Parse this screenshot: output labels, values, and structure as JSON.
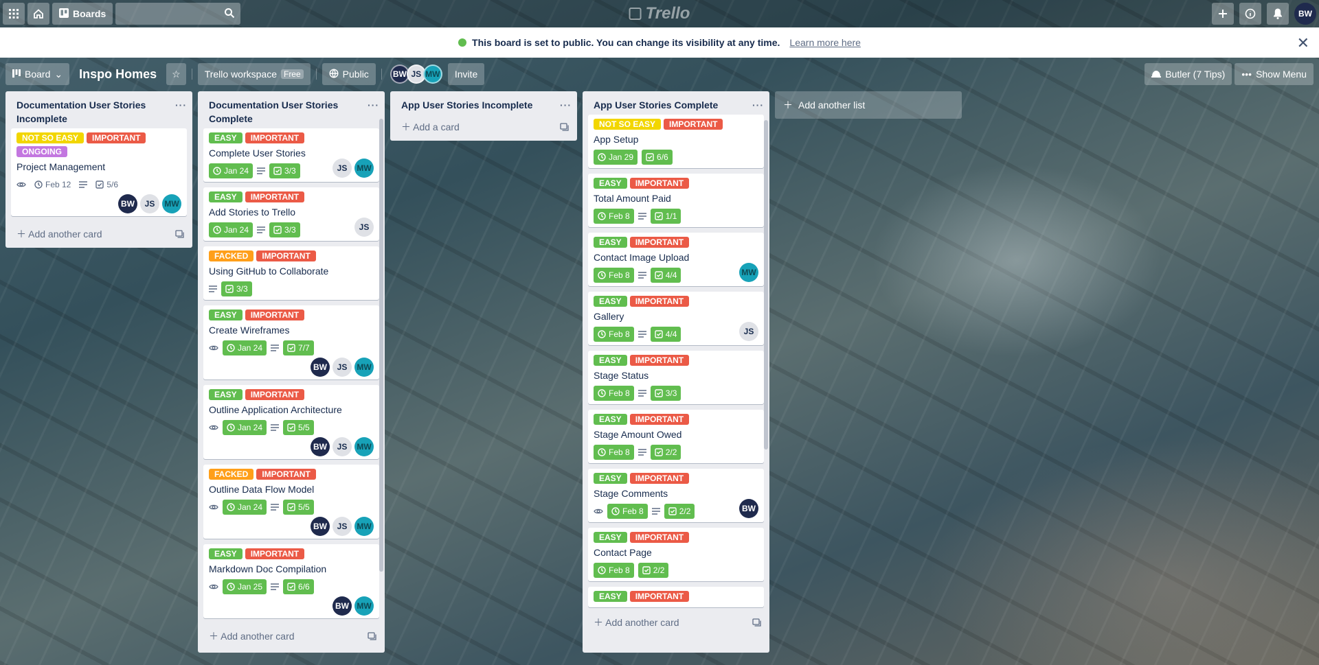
{
  "nav": {
    "boards_label": "Boards",
    "logo_text": "Trello",
    "user_initials": "BW"
  },
  "banner": {
    "message": "This board is set to public. You can change its visibility at any time.",
    "link": "Learn more here"
  },
  "header": {
    "view_label": "Board",
    "title": "Inspo Homes",
    "workspace": "Trello workspace",
    "workspace_plan": "Free",
    "visibility": "Public",
    "invite": "Invite",
    "butler": "Butler (7 Tips)",
    "show_menu": "Show Menu",
    "members": [
      "BW",
      "JS",
      "MW"
    ]
  },
  "add_list": "Add another list",
  "lists": [
    {
      "title": "Documentation User Stories Incomplete",
      "add": "Add another card",
      "cards": [
        {
          "labels": [
            {
              "text": "NOT SO EASY",
              "color": "yellow"
            },
            {
              "text": "IMPORTANT",
              "color": "red"
            },
            {
              "text": "ONGOING",
              "color": "purple"
            }
          ],
          "title": "Project Management",
          "watch": true,
          "date": "Feb 12",
          "date_done": false,
          "desc": true,
          "checklist": "5/6",
          "check_done": false,
          "members": [
            "BW",
            "JS",
            "MW"
          ]
        }
      ]
    },
    {
      "title": "Documentation User Stories Complete",
      "add": "Add another card",
      "cards": [
        {
          "labels": [
            {
              "text": "EASY",
              "color": "green"
            },
            {
              "text": "IMPORTANT",
              "color": "red"
            }
          ],
          "title": "Complete User Stories",
          "date": "Jan 24",
          "desc": true,
          "checklist": "3/3",
          "members_right": [
            "JS",
            "MW"
          ]
        },
        {
          "labels": [
            {
              "text": "EASY",
              "color": "green"
            },
            {
              "text": "IMPORTANT",
              "color": "red"
            }
          ],
          "title": "Add Stories to Trello",
          "date": "Jan 24",
          "desc": true,
          "checklist": "3/3",
          "members_right": [
            "JS"
          ]
        },
        {
          "labels": [
            {
              "text": "FACKED",
              "color": "orange"
            },
            {
              "text": "IMPORTANT",
              "color": "red"
            }
          ],
          "title": "Using GitHub to Collaborate",
          "desc": true,
          "checklist": "3/3"
        },
        {
          "labels": [
            {
              "text": "EASY",
              "color": "green"
            },
            {
              "text": "IMPORTANT",
              "color": "red"
            }
          ],
          "title": "Create Wireframes",
          "watch": true,
          "date": "Jan 24",
          "desc": true,
          "checklist": "7/7",
          "members": [
            "BW",
            "JS",
            "MW"
          ]
        },
        {
          "labels": [
            {
              "text": "EASY",
              "color": "green"
            },
            {
              "text": "IMPORTANT",
              "color": "red"
            }
          ],
          "title": "Outline Application Architecture",
          "watch": true,
          "date": "Jan 24",
          "desc": true,
          "checklist": "5/5",
          "members": [
            "BW",
            "JS",
            "MW"
          ]
        },
        {
          "labels": [
            {
              "text": "FACKED",
              "color": "orange"
            },
            {
              "text": "IMPORTANT",
              "color": "red"
            }
          ],
          "title": "Outline Data Flow Model",
          "watch": true,
          "date": "Jan 24",
          "desc": true,
          "checklist": "5/5",
          "members": [
            "BW",
            "JS",
            "MW"
          ]
        },
        {
          "labels": [
            {
              "text": "EASY",
              "color": "green"
            },
            {
              "text": "IMPORTANT",
              "color": "red"
            }
          ],
          "title": "Markdown Doc Compilation",
          "watch": true,
          "date": "Jan 25",
          "desc": true,
          "checklist": "6/6",
          "members": [
            "BW",
            "MW"
          ]
        }
      ]
    },
    {
      "title": "App User Stories Incomplete",
      "add": "Add a card",
      "cards": []
    },
    {
      "title": "App User Stories Complete",
      "add": "Add another card",
      "cards": [
        {
          "labels": [
            {
              "text": "NOT SO EASY",
              "color": "yellow"
            },
            {
              "text": "IMPORTANT",
              "color": "red"
            }
          ],
          "title": "App Setup",
          "date": "Jan 29",
          "checklist": "6/6"
        },
        {
          "labels": [
            {
              "text": "EASY",
              "color": "green"
            },
            {
              "text": "IMPORTANT",
              "color": "red"
            }
          ],
          "title": "Total Amount Paid",
          "date": "Feb 8",
          "desc": true,
          "checklist": "1/1"
        },
        {
          "labels": [
            {
              "text": "EASY",
              "color": "green"
            },
            {
              "text": "IMPORTANT",
              "color": "red"
            }
          ],
          "title": "Contact Image Upload",
          "date": "Feb 8",
          "desc": true,
          "checklist": "4/4",
          "members_right": [
            "MW"
          ]
        },
        {
          "labels": [
            {
              "text": "EASY",
              "color": "green"
            },
            {
              "text": "IMPORTANT",
              "color": "red"
            }
          ],
          "title": "Gallery",
          "date": "Feb 8",
          "desc": true,
          "checklist": "4/4",
          "members_right": [
            "JS"
          ]
        },
        {
          "labels": [
            {
              "text": "EASY",
              "color": "green"
            },
            {
              "text": "IMPORTANT",
              "color": "red"
            }
          ],
          "title": "Stage Status",
          "date": "Feb 8",
          "desc": true,
          "checklist": "3/3"
        },
        {
          "labels": [
            {
              "text": "EASY",
              "color": "green"
            },
            {
              "text": "IMPORTANT",
              "color": "red"
            }
          ],
          "title": "Stage Amount Owed",
          "date": "Feb 8",
          "desc": true,
          "checklist": "2/2"
        },
        {
          "labels": [
            {
              "text": "EASY",
              "color": "green"
            },
            {
              "text": "IMPORTANT",
              "color": "red"
            }
          ],
          "title": "Stage Comments",
          "watch": true,
          "date": "Feb 8",
          "desc": true,
          "checklist": "2/2",
          "members_right": [
            "BW"
          ]
        },
        {
          "labels": [
            {
              "text": "EASY",
              "color": "green"
            },
            {
              "text": "IMPORTANT",
              "color": "red"
            }
          ],
          "title": "Contact Page",
          "date": "Feb 8",
          "checklist": "2/2"
        },
        {
          "labels": [
            {
              "text": "EASY",
              "color": "green"
            },
            {
              "text": "IMPORTANT",
              "color": "red"
            }
          ],
          "title": ""
        }
      ]
    }
  ]
}
